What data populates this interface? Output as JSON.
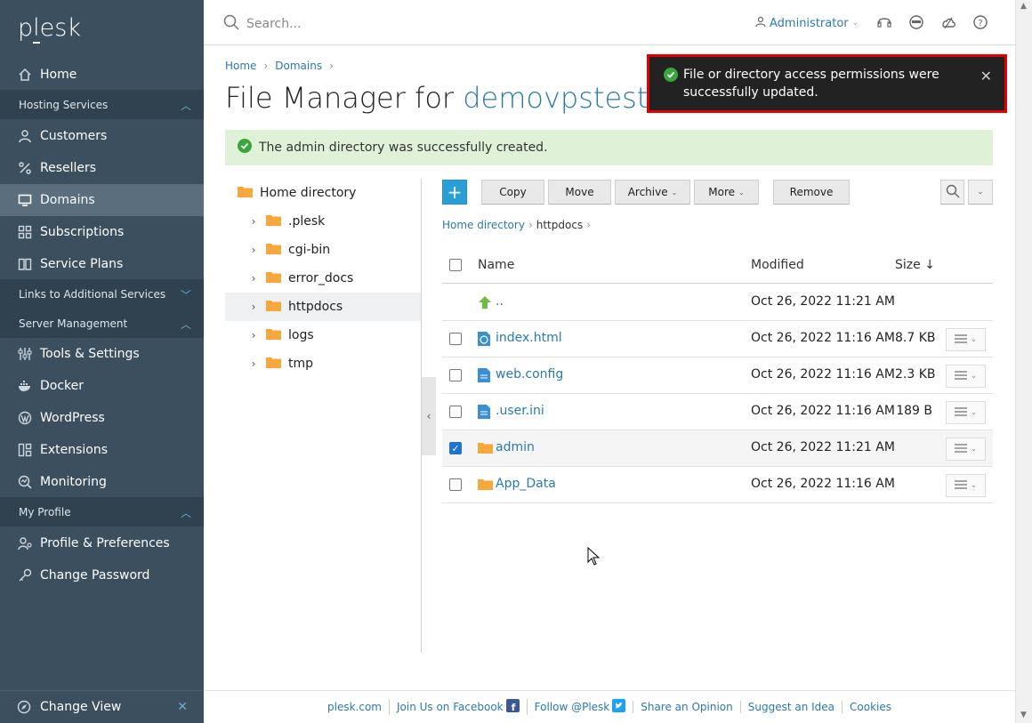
{
  "sidebar": {
    "logo": "plesk",
    "items": [
      {
        "label": "Home",
        "icon": "home-icon"
      },
      {
        "group": "Hosting Services"
      },
      {
        "label": "Customers",
        "icon": "user-icon"
      },
      {
        "label": "Resellers",
        "icon": "percent-icon"
      },
      {
        "label": "Domains",
        "icon": "monitor-icon"
      },
      {
        "label": "Subscriptions",
        "icon": "grid-icon"
      },
      {
        "label": "Service Plans",
        "icon": "book-icon"
      },
      {
        "group": "Links to Additional Services"
      },
      {
        "group": "Server Management"
      },
      {
        "label": "Tools & Settings",
        "icon": "sliders-icon"
      },
      {
        "label": "Docker",
        "icon": "docker-icon"
      },
      {
        "label": "WordPress",
        "icon": "wordpress-icon"
      },
      {
        "label": "Extensions",
        "icon": "extensions-icon"
      },
      {
        "label": "Monitoring",
        "icon": "monitoring-icon"
      },
      {
        "group": "My Profile"
      },
      {
        "label": "Profile & Preferences",
        "icon": "profile-icon"
      },
      {
        "label": "Change Password",
        "icon": "key-icon"
      }
    ],
    "change_view": "Change View"
  },
  "topbar": {
    "search_placeholder": "Search...",
    "user": "Administrator"
  },
  "breadcrumb": [
    "Home",
    "Domains"
  ],
  "page": {
    "title_prefix": "File Manager for ",
    "domain": "demovpstest.co"
  },
  "success_message": "The admin directory was successfully created.",
  "toast": {
    "message": "File or directory access permissions were successfully updated."
  },
  "tree": {
    "root": "Home directory",
    "items": [
      ".plesk",
      "cgi-bin",
      "error_docs",
      "httpdocs",
      "logs",
      "tmp"
    ],
    "selected": "httpdocs"
  },
  "toolbar": {
    "add": "+",
    "copy": "Copy",
    "move": "Move",
    "archive": "Archive",
    "more": "More",
    "remove": "Remove"
  },
  "path": {
    "root": "Home directory",
    "current": "httpdocs"
  },
  "table": {
    "headers": {
      "name": "Name",
      "modified": "Modified",
      "size": "Size ↓"
    },
    "rows": [
      {
        "name": "..",
        "modified": "Oct 26, 2022 11:21 AM",
        "size": "",
        "type": "up"
      },
      {
        "name": "index.html",
        "modified": "Oct 26, 2022 11:16 AM",
        "size": "8.7 KB",
        "type": "html"
      },
      {
        "name": "web.config",
        "modified": "Oct 26, 2022 11:16 AM",
        "size": "2.3 KB",
        "type": "file"
      },
      {
        "name": ".user.ini",
        "modified": "Oct 26, 2022 11:16 AM",
        "size": "189 B",
        "type": "file"
      },
      {
        "name": "admin",
        "modified": "Oct 26, 2022 11:21 AM",
        "size": "",
        "type": "folder",
        "checked": true
      },
      {
        "name": "App_Data",
        "modified": "Oct 26, 2022 11:16 AM",
        "size": "",
        "type": "folder"
      }
    ]
  },
  "footer": [
    "plesk.com",
    "Join Us on Facebook",
    "Follow @Plesk",
    "Share an Opinion",
    "Suggest an Idea",
    "Cookies"
  ],
  "colors": {
    "sidebar": "#3c4f5e",
    "accent": "#2a7ab0",
    "success_bg": "#dff2d8",
    "toast_border": "#e40000"
  }
}
